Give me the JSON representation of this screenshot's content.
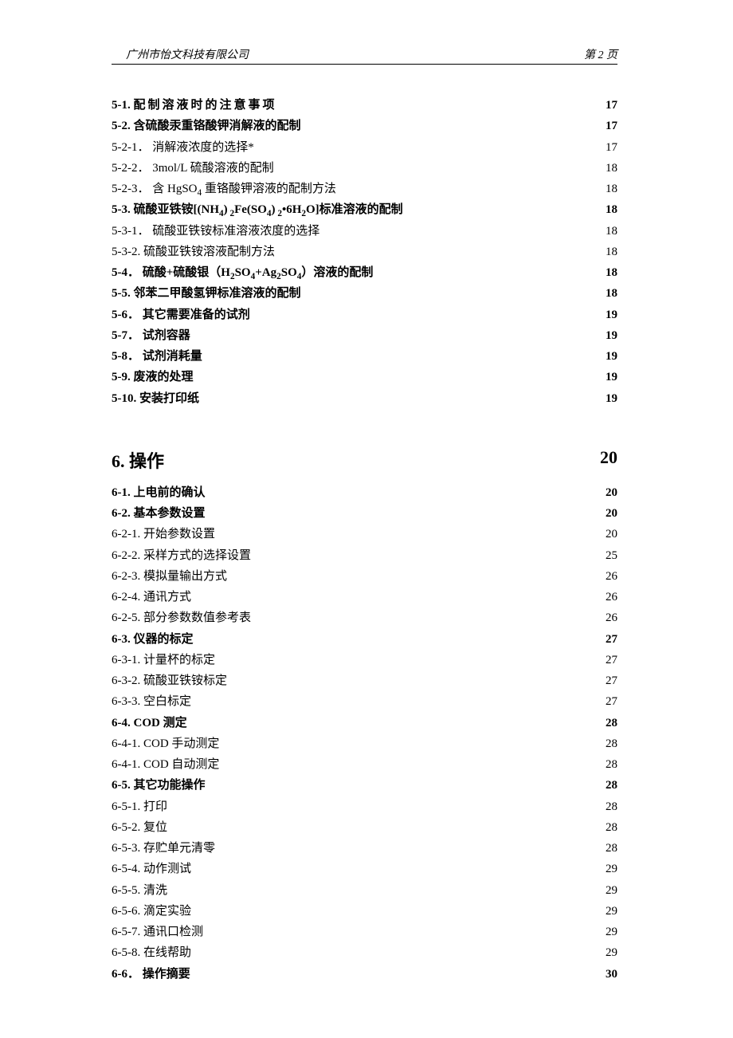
{
  "header": {
    "company": "广州市怡文科技有限公司",
    "page_label": "第 2 页"
  },
  "section5": {
    "items": [
      {
        "title": "5-1.  配制溶液时的注意事项",
        "page": "17",
        "bold": true,
        "spaced": true
      },
      {
        "title": "5-2.  含硫酸汞重铬酸钾消解液的配制",
        "page": "17",
        "bold": true
      },
      {
        "title": "5-2-1．  消解液浓度的选择*",
        "page": "17"
      },
      {
        "title": "5-2-2．  3mol/L 硫酸溶液的配制",
        "page": "18"
      },
      {
        "title_html": "5-2-3．  含 HgSO<sub class='chem'>4</sub> 重铬酸钾溶液的配制方法",
        "page": "18"
      },
      {
        "title_html": "5-3.  硫酸亚铁铵[(NH<sub class='chem'>4</sub>)<sub class='chem'> 2</sub>Fe(SO<sub class='chem'>4</sub>)<sub class='chem'> 2</sub>•6H<sub class='chem'>2</sub>O]标准溶液的配制",
        "page": "18",
        "bold": true
      },
      {
        "title": "5-3-1．  硫酸亚铁铵标准溶液浓度的选择",
        "page": "18"
      },
      {
        "title": "5-3-2.   硫酸亚铁铵溶液配制方法",
        "page": "18"
      },
      {
        "title_html": "5-4．  硫酸+硫酸银（H<sub class='chem'>2</sub>SO<sub class='chem'>4</sub>+Ag<sub class='chem'>2</sub>SO<sub class='chem'>4</sub>）溶液的配制",
        "page": "18",
        "bold": true
      },
      {
        "title": "5-5.  邻苯二甲酸氢钾标准溶液的配制",
        "page": "18",
        "bold": true
      },
      {
        "title": "5-6． 其它需要准备的试剂",
        "page": "19",
        "bold": true
      },
      {
        "title": "5-7． 试剂容器",
        "page": "19",
        "bold": true
      },
      {
        "title": "5-8． 试剂消耗量",
        "page": "19",
        "bold": true
      },
      {
        "title": "5-9.  废液的处理",
        "page": "19",
        "bold": true
      },
      {
        "title": "5-10.  安装打印纸",
        "page": "19",
        "bold": true
      }
    ]
  },
  "section6": {
    "head": {
      "title": "6.  操作",
      "page": "20"
    },
    "items": [
      {
        "title": "6-1.  上电前的确认",
        "page": "20",
        "bold": true
      },
      {
        "title": "6-2.  基本参数设置",
        "page": "20",
        "bold": true
      },
      {
        "title": "6-2-1.  开始参数设置",
        "page": "20"
      },
      {
        "title": "6-2-2.  采样方式的选择设置",
        "page": "25"
      },
      {
        "title": "6-2-3.  模拟量输出方式",
        "page": "26"
      },
      {
        "title": "6-2-4.  通讯方式",
        "page": "26"
      },
      {
        "title": "6-2-5.  部分参数数值参考表",
        "page": "26"
      },
      {
        "title": "6-3.  仪器的标定",
        "page": "27",
        "bold": true
      },
      {
        "title": "6-3-1.  计量杯的标定",
        "page": "27"
      },
      {
        "title": "6-3-2.  硫酸亚铁铵标定",
        "page": "27"
      },
      {
        "title": "6-3-3.  空白标定",
        "page": "27"
      },
      {
        "title": "6-4. COD 测定",
        "page": "28",
        "bold": true
      },
      {
        "title": "6-4-1. COD 手动测定",
        "page": "28"
      },
      {
        "title": "6-4-1. COD 自动测定",
        "page": "28"
      },
      {
        "title": "6-5.  其它功能操作",
        "page": "28",
        "bold": true
      },
      {
        "title": "6-5-1.  打印",
        "page": "28"
      },
      {
        "title": "6-5-2.  复位",
        "page": "28"
      },
      {
        "title": "6-5-3.  存贮单元清零",
        "page": "28"
      },
      {
        "title": "6-5-4.  动作测试",
        "page": "29"
      },
      {
        "title": "6-5-5.  清洗",
        "page": "29"
      },
      {
        "title": "6-5-6.  滴定实验",
        "page": "29"
      },
      {
        "title": "6-5-7.  通讯口检测",
        "page": "29"
      },
      {
        "title": "6-5-8.  在线帮助",
        "page": "29"
      },
      {
        "title": "6-6． 操作摘要",
        "page": "30",
        "bold": true
      }
    ]
  }
}
